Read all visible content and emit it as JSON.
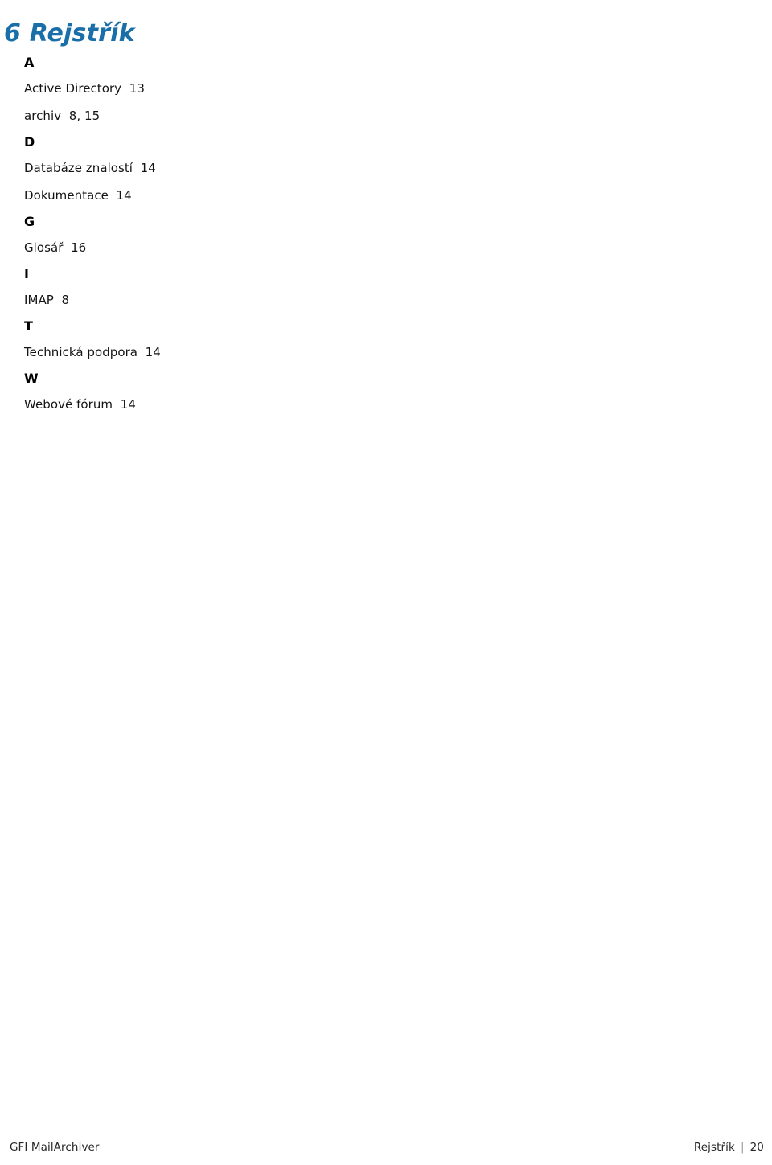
{
  "document": {
    "chapter_number": "6",
    "chapter_title": "Rejstřík",
    "heading_full": "6 Rejstřík",
    "heading_color": "#1B6FA8"
  },
  "index": {
    "groups": [
      {
        "letter": "A",
        "entries": [
          {
            "term": "Active Directory",
            "pages": "13",
            "line": "Active Directory  13"
          },
          {
            "term": "archiv",
            "pages": "8, 15",
            "line": "archiv  8, 15"
          }
        ]
      },
      {
        "letter": "D",
        "entries": [
          {
            "term": "Databáze znalostí",
            "pages": "14",
            "line": "Databáze znalostí  14"
          },
          {
            "term": "Dokumentace",
            "pages": "14",
            "line": "Dokumentace  14"
          }
        ]
      },
      {
        "letter": "G",
        "entries": [
          {
            "term": "Glosář",
            "pages": "16",
            "line": "Glosář  16"
          }
        ]
      },
      {
        "letter": "I",
        "entries": [
          {
            "term": "IMAP",
            "pages": "8",
            "line": "IMAP  8"
          }
        ]
      },
      {
        "letter": "T",
        "entries": [
          {
            "term": "Technická podpora",
            "pages": "14",
            "line": "Technická podpora  14"
          }
        ]
      },
      {
        "letter": "W",
        "entries": [
          {
            "term": "Webové fórum",
            "pages": "14",
            "line": "Webové fórum  14"
          }
        ]
      }
    ]
  },
  "footer": {
    "product": "GFI MailArchiver",
    "section": "Rejstřík",
    "separator": "|",
    "page_number": "20"
  }
}
